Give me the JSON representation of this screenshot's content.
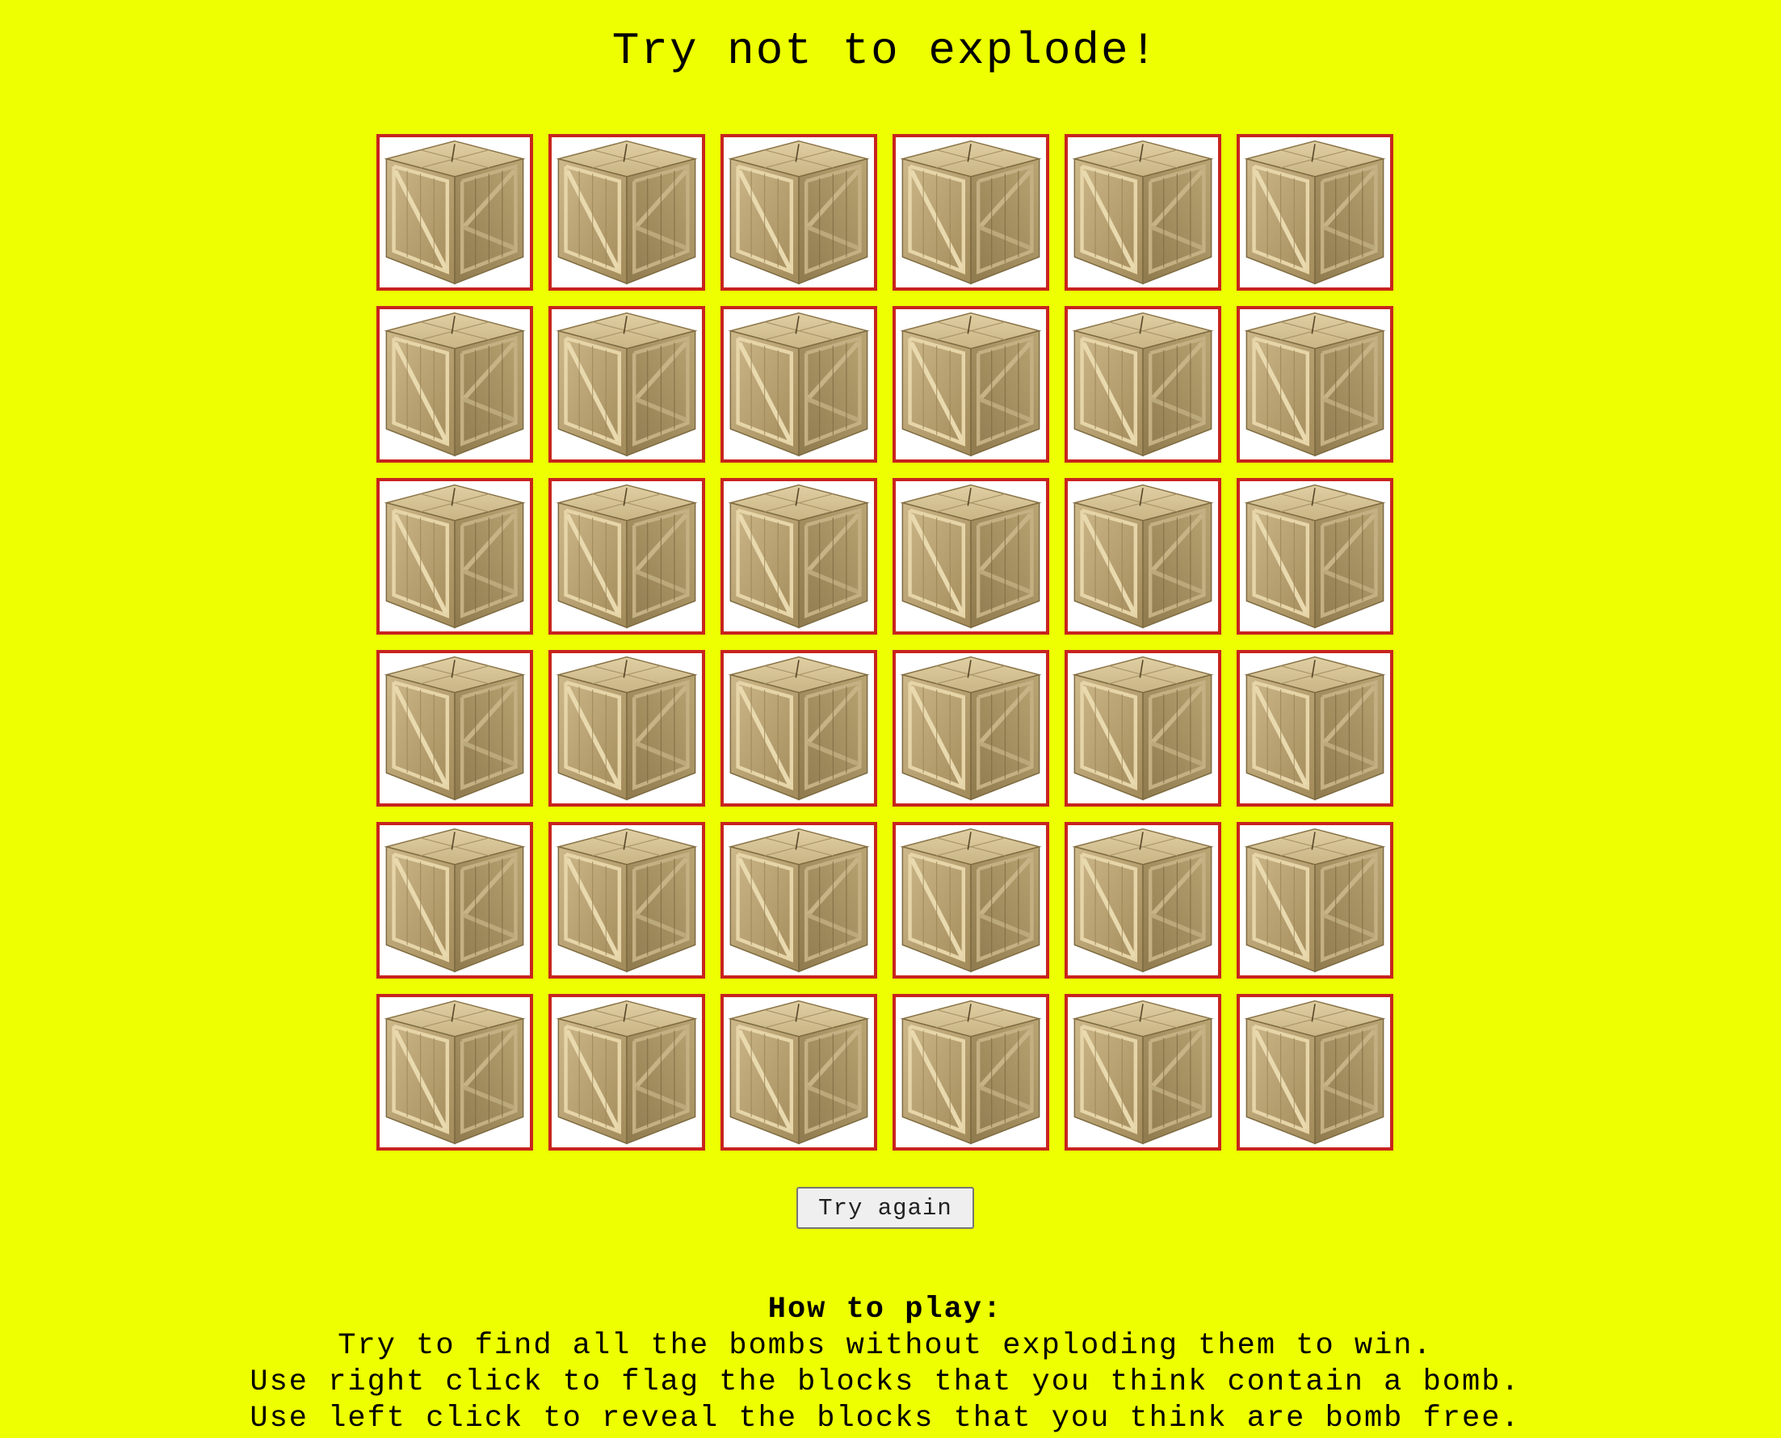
{
  "title": "Try not to explode!",
  "board": {
    "rows": 6,
    "columns": 6,
    "cell_state": "hidden-crate",
    "border_color": "#c8231f",
    "background_color": "#edff00"
  },
  "buttons": {
    "try_again_label": "Try again"
  },
  "instructions": {
    "heading": "How to play:",
    "lines": [
      "Try to find all the bombs without exploding them to win.",
      "Use right click to flag the blocks that you think contain a bomb.",
      "Use left click to reveal the blocks that you think are bomb free."
    ]
  },
  "icons": {
    "cell_icon": "wooden-crate-icon"
  }
}
